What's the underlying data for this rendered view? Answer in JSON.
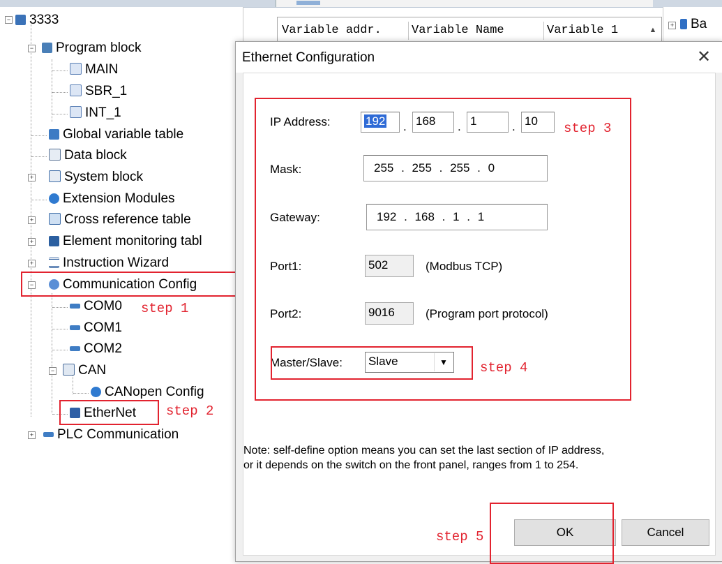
{
  "tree": {
    "root": "3333",
    "items": [
      {
        "label": "Program block"
      },
      {
        "label": "MAIN"
      },
      {
        "label": "SBR_1"
      },
      {
        "label": "INT_1"
      },
      {
        "label": "Global variable table"
      },
      {
        "label": "Data block"
      },
      {
        "label": "System block"
      },
      {
        "label": "Extension Modules"
      },
      {
        "label": "Cross reference table"
      },
      {
        "label": "Element monitoring tabl"
      },
      {
        "label": "Instruction Wizard"
      },
      {
        "label": "Communication Config"
      },
      {
        "label": "COM0"
      },
      {
        "label": "COM1"
      },
      {
        "label": "COM2"
      },
      {
        "label": "CAN"
      },
      {
        "label": "CANopen Config"
      },
      {
        "label": "EtherNet"
      },
      {
        "label": "PLC Communication"
      }
    ]
  },
  "variable_table": {
    "columns": [
      "Variable addr.",
      "Variable Name",
      "Variable 1"
    ]
  },
  "right_panel": {
    "item": "Ba"
  },
  "dialog": {
    "title": "Ethernet Configuration",
    "close_glyph": "✕",
    "ip_label": "IP Address:",
    "ip": [
      "192",
      "168",
      "1",
      "10"
    ],
    "mask_label": "Mask:",
    "mask": "255 . 255 . 255 . 0",
    "gateway_label": "Gateway:",
    "gateway": "192 . 168 . 1 . 1",
    "port1_label": "Port1:",
    "port1": "502",
    "port1_desc": "(Modbus TCP)",
    "port2_label": "Port2:",
    "port2": "9016",
    "port2_desc": "(Program port protocol)",
    "ms_label": "Master/Slave:",
    "ms_value": "Slave",
    "note_line1": "Note: self-define option means you can set the last section of IP address,",
    "note_line2": "or it depends on the switch on the front panel, ranges from 1 to 254.",
    "ok": "OK",
    "cancel": "Cancel"
  },
  "annotations": {
    "step1": "step 1",
    "step2": "step 2",
    "step3": "step 3",
    "step4": "step 4",
    "step5": "step 5"
  },
  "colors": {
    "annotation_red": "#e2232f",
    "selection_blue": "#2f6bd6"
  },
  "icons": [
    "computer-icon",
    "program-block-icon",
    "main-icon",
    "sbr-icon",
    "int-icon",
    "chart-icon",
    "data-block-icon",
    "system-block-icon",
    "gear-icon",
    "cross-table-icon",
    "monitor-icon",
    "wizard-icon",
    "communication-icon",
    "com-port-icon",
    "can-icon",
    "ethernet-icon",
    "dropdown-arrow-icon",
    "close-icon"
  ]
}
